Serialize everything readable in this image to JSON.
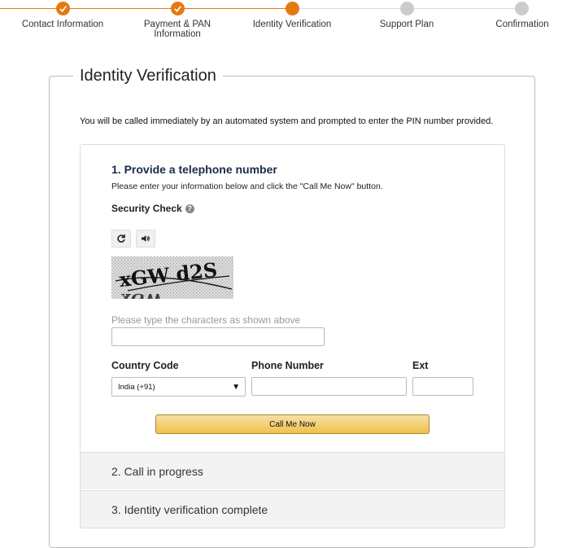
{
  "stepper": {
    "steps": [
      {
        "label": "Contact Information",
        "state": "done"
      },
      {
        "label": "Payment & PAN\nInformation",
        "state": "done"
      },
      {
        "label": "Identity Verification",
        "state": "current"
      },
      {
        "label": "Support Plan",
        "state": "todo"
      },
      {
        "label": "Confirmation",
        "state": "todo"
      }
    ],
    "accent_color": "#e47911"
  },
  "page": {
    "title": "Identity Verification",
    "intro": "You will be called immediately by an automated system and prompted to enter the PIN number provided."
  },
  "step1": {
    "title": "1. Provide a telephone number",
    "subtitle": "Please enter your information below and click the \"Call Me Now\" button.",
    "security_check_label": "Security Check",
    "captcha_hint": "Please type the characters as shown above",
    "country_code_label": "Country Code",
    "country_code_value": "India (+91)",
    "phone_label": "Phone Number",
    "ext_label": "Ext",
    "call_button": "Call Me Now",
    "captcha_image_text": "xGW d2S"
  },
  "step2": {
    "title": "2. Call in progress"
  },
  "step3": {
    "title": "3. Identity verification complete"
  },
  "icons": {
    "refresh": "refresh-icon",
    "audio": "speaker-icon",
    "help": "question-circle-icon",
    "check": "check-icon"
  }
}
